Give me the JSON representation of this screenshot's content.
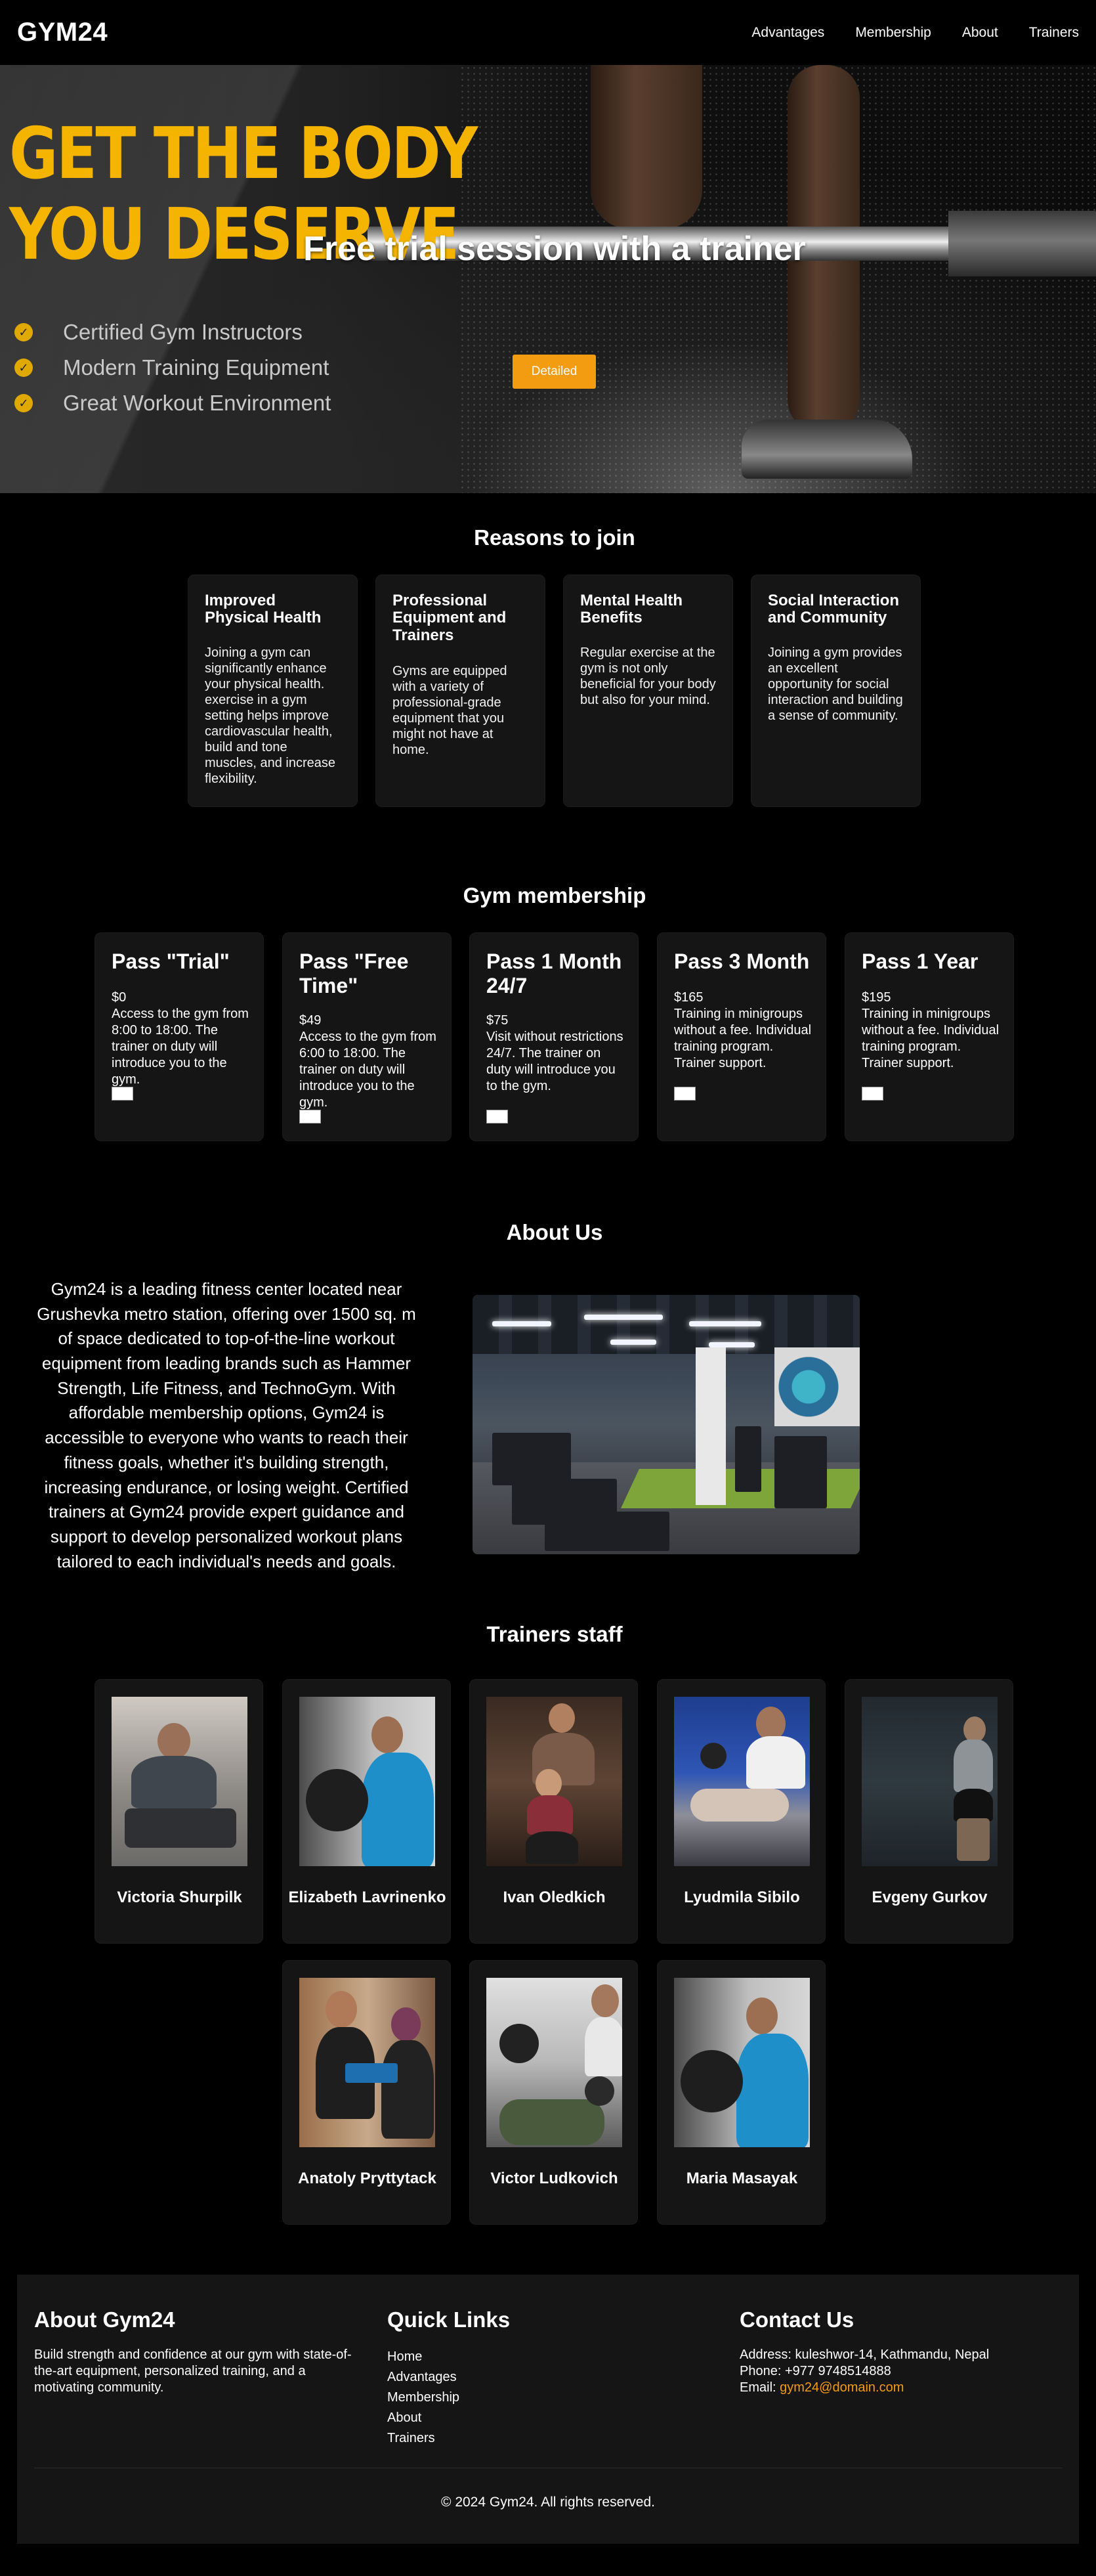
{
  "nav": {
    "logo": "GYM24",
    "links": [
      "Advantages",
      "Membership",
      "About",
      "Trainers"
    ]
  },
  "hero": {
    "headline_line1": "GET THE BODY",
    "headline_line2": "YOU DESERVE",
    "checklist": [
      "Certified Gym Instructors",
      "Modern Training Equipment",
      "Great Workout Environment"
    ],
    "title": "Free trial session with a trainer",
    "button": "Detailed",
    "accent_color": "#f5b400",
    "button_color": "#f39c12"
  },
  "reasons": {
    "title": "Reasons to join",
    "cards": [
      {
        "title": "Improved Physical Health",
        "text": "Joining a gym can significantly enhance your physical health. exercise in a gym setting helps improve cardiovascular health, build and tone muscles, and increase flexibility."
      },
      {
        "title": "Professional Equipment and Trainers",
        "text": "Gyms are equipped with a variety of professional-grade equipment that you might not have at home."
      },
      {
        "title": "Mental Health Benefits",
        "text": "Regular exercise at the gym is not only beneficial for your body but also for your mind."
      },
      {
        "title": "Social Interaction and Community",
        "text": "Joining a gym provides an excellent opportunity for social interaction and building a sense of community."
      }
    ]
  },
  "membership": {
    "title": "Gym membership",
    "passes": [
      {
        "name": "Pass \"Trial\"",
        "price": "$0",
        "text": "Access to the gym from 8:00 to 18:00. The trainer on duty will introduce you to the gym."
      },
      {
        "name": "Pass \"Free Time\"",
        "price": "$49",
        "text": "Access to the gym from 6:00 to 18:00. The trainer on duty will introduce you to the gym."
      },
      {
        "name": "Pass 1 Month 24/7",
        "price": "$75",
        "text": "Visit without restrictions 24/7. The trainer on duty will introduce you to the gym."
      },
      {
        "name": "Pass 3 Month",
        "price": "$165",
        "text": "Training in minigroups without a fee. Individual training program. Trainer support."
      },
      {
        "name": "Pass 1 Year",
        "price": "$195",
        "text": "Training in minigroups without a fee. Individual training program. Trainer support."
      }
    ]
  },
  "about": {
    "title": "About Us",
    "text": "Gym24 is a leading fitness center located near Grushevka metro station, offering over 1500 sq. m of space dedicated to top-of-the-line workout equipment from leading brands such as Hammer Strength, Life Fitness, and TechnoGym. With affordable membership options, Gym24 is accessible to everyone who wants to reach their fitness goals, whether it's building strength, increasing endurance, or losing weight. Certified trainers at Gym24 provide expert guidance and support to develop personalized workout plans tailored to each individual's needs and goals."
  },
  "trainers": {
    "title": "Trainers staff",
    "people": [
      "Victoria Shurpilk",
      "Elizabeth Lavrinenko",
      "Ivan Oledkich",
      "Lyudmila Sibilo",
      "Evgeny Gurkov",
      "Anatoly Pryttytack",
      "Victor Ludkovich",
      "Maria Masayak"
    ]
  },
  "footer": {
    "about_title": "About Gym24",
    "about_text": "Build strength and confidence at our gym with state-of-the-art equipment, personalized training, and a motivating community.",
    "links_title": "Quick Links",
    "links": [
      "Home",
      "Advantages",
      "Membership",
      "About",
      "Trainers"
    ],
    "contact_title": "Contact Us",
    "address": "Address: kuleshwor-14, Kathmandu, Nepal",
    "phone": "Phone: +977 9748514888",
    "email_label": "Email: ",
    "email": "gym24@domain.com",
    "copyright": "© 2024 Gym24. All rights reserved."
  }
}
